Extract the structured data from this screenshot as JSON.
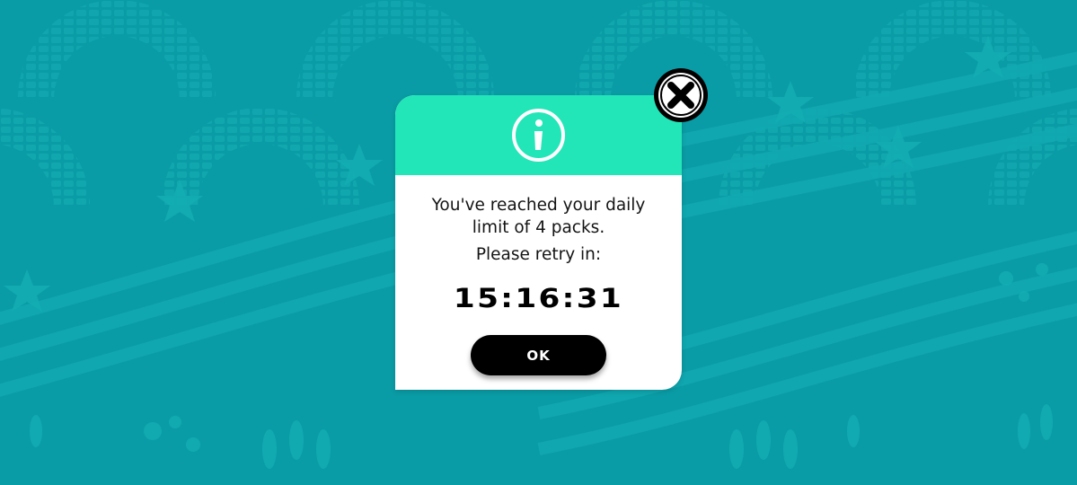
{
  "dialog": {
    "icon": "info-icon",
    "message": "You've reached your daily limit of 4 packs.",
    "message_line1": "You've reached your daily",
    "message_line2": "limit of 4 packs.",
    "retry_text": "Please retry in:",
    "countdown": "15:16:31",
    "ok_label": "OK",
    "close_icon": "close-icon"
  },
  "colors": {
    "background": "#0a9ca6",
    "header": "#22e6b8",
    "button": "#000000"
  }
}
